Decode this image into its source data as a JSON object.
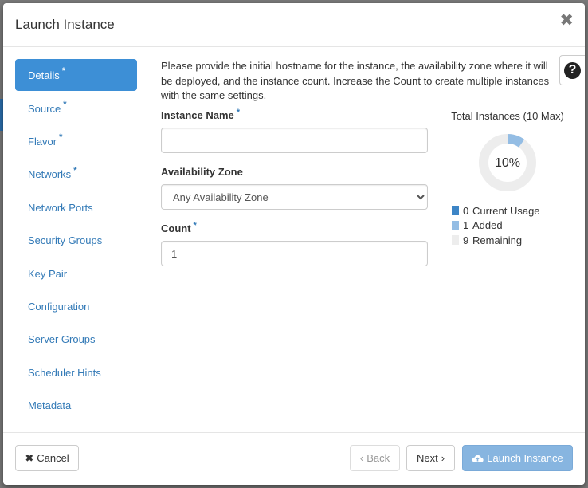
{
  "modal": {
    "title": "Launch Instance",
    "close_glyph": "✖",
    "help_glyph": "?"
  },
  "nav": {
    "items": [
      {
        "label": "Details",
        "required": "*"
      },
      {
        "label": "Source",
        "required": "*"
      },
      {
        "label": "Flavor",
        "required": "*"
      },
      {
        "label": "Networks",
        "required": "*"
      },
      {
        "label": "Network Ports"
      },
      {
        "label": "Security Groups"
      },
      {
        "label": "Key Pair"
      },
      {
        "label": "Configuration"
      },
      {
        "label": "Server Groups"
      },
      {
        "label": "Scheduler Hints"
      },
      {
        "label": "Metadata"
      }
    ],
    "active": "Details"
  },
  "details": {
    "intro": "Please provide the initial hostname for the instance, the availability zone where it will be deployed, and the instance count. Increase the Count to create multiple instances with the same settings.",
    "instance_name": {
      "label": "Instance Name",
      "required": "*",
      "value": ""
    },
    "availability_zone": {
      "label": "Availability Zone",
      "selected": "Any Availability Zone"
    },
    "count": {
      "label": "Count",
      "required": "*",
      "value": "1"
    }
  },
  "quota": {
    "title": "Total Instances (10 Max)",
    "percent_label": "10%",
    "max": 10,
    "legend": [
      {
        "count": "0",
        "label": "Current Usage",
        "color": "#3d85c6"
      },
      {
        "count": "1",
        "label": "Added",
        "color": "#94bde4"
      },
      {
        "count": "9",
        "label": "Remaining",
        "color": "#ededed"
      }
    ]
  },
  "footer": {
    "cancel_label": "Cancel",
    "back_label": "Back",
    "next_label": "Next",
    "launch_label": "Launch Instance"
  },
  "colors": {
    "accent": "#3d8fd6",
    "link": "#337ab7",
    "launch_button": "#87b5e0"
  }
}
